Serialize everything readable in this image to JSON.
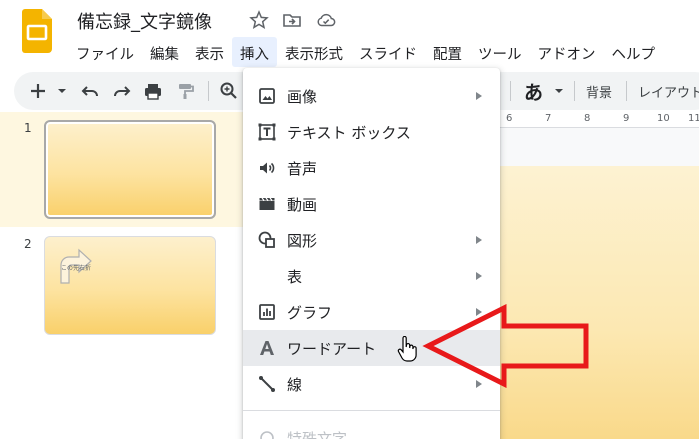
{
  "app": {
    "document_title": "備忘録_文字鏡像",
    "logo_icon": "google-slides-logo-icon",
    "title_icons": [
      "star-icon",
      "move-to-folder-icon",
      "cloud-saved-icon"
    ]
  },
  "menubar": {
    "items": [
      "ファイル",
      "編集",
      "表示",
      "挿入",
      "表示形式",
      "スライド",
      "配置",
      "ツール",
      "アドオン",
      "ヘルプ"
    ],
    "active_index": 3
  },
  "toolbar": {
    "icons": [
      "add-icon",
      "dropdown-icon",
      "undo-icon",
      "redo-icon",
      "print-icon",
      "paint-format-icon",
      "zoom-icon"
    ],
    "input_tool": "あ",
    "background_label": "背景",
    "layout_label": "レイアウト"
  },
  "ruler": {
    "numbers": [
      "6",
      "7",
      "8",
      "9",
      "10",
      "11"
    ]
  },
  "slides": [
    {
      "number": "1",
      "selected": true,
      "label": ""
    },
    {
      "number": "2",
      "selected": false,
      "label": "この先右折"
    }
  ],
  "insert_menu": {
    "items": [
      {
        "label": "画像",
        "icon": "image-icon",
        "submenu": true
      },
      {
        "label": "テキスト ボックス",
        "icon": "text-box-icon",
        "submenu": false
      },
      {
        "label": "音声",
        "icon": "audio-icon",
        "submenu": false
      },
      {
        "label": "動画",
        "icon": "video-icon",
        "submenu": false
      },
      {
        "label": "図形",
        "icon": "shape-icon",
        "submenu": true
      },
      {
        "label": "表",
        "icon": "",
        "submenu": true
      },
      {
        "label": "グラフ",
        "icon": "chart-icon",
        "submenu": true
      },
      {
        "label": "ワードアート",
        "icon": "word-art-icon",
        "submenu": false,
        "hovered": true
      },
      {
        "label": "線",
        "icon": "line-icon",
        "submenu": true
      },
      {
        "label": "特殊文字",
        "icon": "omega-icon",
        "submenu": false,
        "disabled": true
      }
    ]
  },
  "annotation": {
    "arrow_color": "#e8191a",
    "points_to": "ワードアート"
  },
  "colors": {
    "accent": "#f4b400",
    "menu_highlight": "#e8f0fe",
    "hover": "#e8eaed"
  }
}
